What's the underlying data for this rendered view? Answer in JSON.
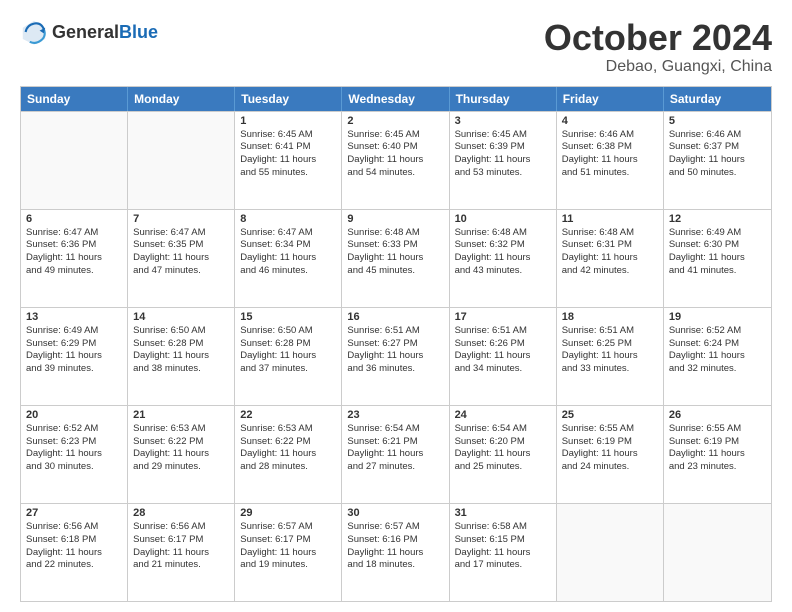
{
  "header": {
    "logo_general": "General",
    "logo_blue": "Blue",
    "month_year": "October 2024",
    "location": "Debao, Guangxi, China"
  },
  "weekdays": [
    "Sunday",
    "Monday",
    "Tuesday",
    "Wednesday",
    "Thursday",
    "Friday",
    "Saturday"
  ],
  "rows": [
    [
      {
        "day": "",
        "lines": [],
        "empty": true
      },
      {
        "day": "",
        "lines": [],
        "empty": true
      },
      {
        "day": "1",
        "lines": [
          "Sunrise: 6:45 AM",
          "Sunset: 6:41 PM",
          "Daylight: 11 hours",
          "and 55 minutes."
        ]
      },
      {
        "day": "2",
        "lines": [
          "Sunrise: 6:45 AM",
          "Sunset: 6:40 PM",
          "Daylight: 11 hours",
          "and 54 minutes."
        ]
      },
      {
        "day": "3",
        "lines": [
          "Sunrise: 6:45 AM",
          "Sunset: 6:39 PM",
          "Daylight: 11 hours",
          "and 53 minutes."
        ]
      },
      {
        "day": "4",
        "lines": [
          "Sunrise: 6:46 AM",
          "Sunset: 6:38 PM",
          "Daylight: 11 hours",
          "and 51 minutes."
        ]
      },
      {
        "day": "5",
        "lines": [
          "Sunrise: 6:46 AM",
          "Sunset: 6:37 PM",
          "Daylight: 11 hours",
          "and 50 minutes."
        ]
      }
    ],
    [
      {
        "day": "6",
        "lines": [
          "Sunrise: 6:47 AM",
          "Sunset: 6:36 PM",
          "Daylight: 11 hours",
          "and 49 minutes."
        ]
      },
      {
        "day": "7",
        "lines": [
          "Sunrise: 6:47 AM",
          "Sunset: 6:35 PM",
          "Daylight: 11 hours",
          "and 47 minutes."
        ]
      },
      {
        "day": "8",
        "lines": [
          "Sunrise: 6:47 AM",
          "Sunset: 6:34 PM",
          "Daylight: 11 hours",
          "and 46 minutes."
        ]
      },
      {
        "day": "9",
        "lines": [
          "Sunrise: 6:48 AM",
          "Sunset: 6:33 PM",
          "Daylight: 11 hours",
          "and 45 minutes."
        ]
      },
      {
        "day": "10",
        "lines": [
          "Sunrise: 6:48 AM",
          "Sunset: 6:32 PM",
          "Daylight: 11 hours",
          "and 43 minutes."
        ]
      },
      {
        "day": "11",
        "lines": [
          "Sunrise: 6:48 AM",
          "Sunset: 6:31 PM",
          "Daylight: 11 hours",
          "and 42 minutes."
        ]
      },
      {
        "day": "12",
        "lines": [
          "Sunrise: 6:49 AM",
          "Sunset: 6:30 PM",
          "Daylight: 11 hours",
          "and 41 minutes."
        ]
      }
    ],
    [
      {
        "day": "13",
        "lines": [
          "Sunrise: 6:49 AM",
          "Sunset: 6:29 PM",
          "Daylight: 11 hours",
          "and 39 minutes."
        ]
      },
      {
        "day": "14",
        "lines": [
          "Sunrise: 6:50 AM",
          "Sunset: 6:28 PM",
          "Daylight: 11 hours",
          "and 38 minutes."
        ]
      },
      {
        "day": "15",
        "lines": [
          "Sunrise: 6:50 AM",
          "Sunset: 6:28 PM",
          "Daylight: 11 hours",
          "and 37 minutes."
        ]
      },
      {
        "day": "16",
        "lines": [
          "Sunrise: 6:51 AM",
          "Sunset: 6:27 PM",
          "Daylight: 11 hours",
          "and 36 minutes."
        ]
      },
      {
        "day": "17",
        "lines": [
          "Sunrise: 6:51 AM",
          "Sunset: 6:26 PM",
          "Daylight: 11 hours",
          "and 34 minutes."
        ]
      },
      {
        "day": "18",
        "lines": [
          "Sunrise: 6:51 AM",
          "Sunset: 6:25 PM",
          "Daylight: 11 hours",
          "and 33 minutes."
        ]
      },
      {
        "day": "19",
        "lines": [
          "Sunrise: 6:52 AM",
          "Sunset: 6:24 PM",
          "Daylight: 11 hours",
          "and 32 minutes."
        ]
      }
    ],
    [
      {
        "day": "20",
        "lines": [
          "Sunrise: 6:52 AM",
          "Sunset: 6:23 PM",
          "Daylight: 11 hours",
          "and 30 minutes."
        ]
      },
      {
        "day": "21",
        "lines": [
          "Sunrise: 6:53 AM",
          "Sunset: 6:22 PM",
          "Daylight: 11 hours",
          "and 29 minutes."
        ]
      },
      {
        "day": "22",
        "lines": [
          "Sunrise: 6:53 AM",
          "Sunset: 6:22 PM",
          "Daylight: 11 hours",
          "and 28 minutes."
        ]
      },
      {
        "day": "23",
        "lines": [
          "Sunrise: 6:54 AM",
          "Sunset: 6:21 PM",
          "Daylight: 11 hours",
          "and 27 minutes."
        ]
      },
      {
        "day": "24",
        "lines": [
          "Sunrise: 6:54 AM",
          "Sunset: 6:20 PM",
          "Daylight: 11 hours",
          "and 25 minutes."
        ]
      },
      {
        "day": "25",
        "lines": [
          "Sunrise: 6:55 AM",
          "Sunset: 6:19 PM",
          "Daylight: 11 hours",
          "and 24 minutes."
        ]
      },
      {
        "day": "26",
        "lines": [
          "Sunrise: 6:55 AM",
          "Sunset: 6:19 PM",
          "Daylight: 11 hours",
          "and 23 minutes."
        ]
      }
    ],
    [
      {
        "day": "27",
        "lines": [
          "Sunrise: 6:56 AM",
          "Sunset: 6:18 PM",
          "Daylight: 11 hours",
          "and 22 minutes."
        ]
      },
      {
        "day": "28",
        "lines": [
          "Sunrise: 6:56 AM",
          "Sunset: 6:17 PM",
          "Daylight: 11 hours",
          "and 21 minutes."
        ]
      },
      {
        "day": "29",
        "lines": [
          "Sunrise: 6:57 AM",
          "Sunset: 6:17 PM",
          "Daylight: 11 hours",
          "and 19 minutes."
        ]
      },
      {
        "day": "30",
        "lines": [
          "Sunrise: 6:57 AM",
          "Sunset: 6:16 PM",
          "Daylight: 11 hours",
          "and 18 minutes."
        ]
      },
      {
        "day": "31",
        "lines": [
          "Sunrise: 6:58 AM",
          "Sunset: 6:15 PM",
          "Daylight: 11 hours",
          "and 17 minutes."
        ]
      },
      {
        "day": "",
        "lines": [],
        "empty": true
      },
      {
        "day": "",
        "lines": [],
        "empty": true
      }
    ]
  ]
}
